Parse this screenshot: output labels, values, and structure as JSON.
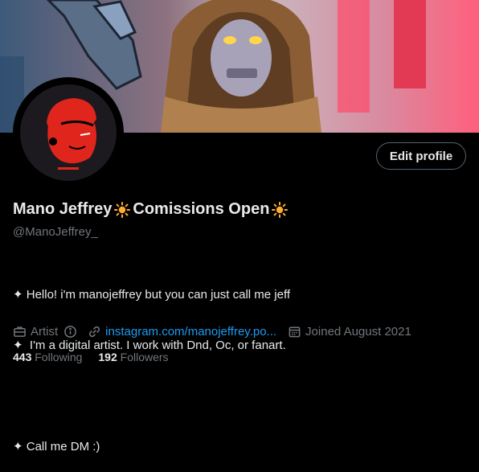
{
  "profile": {
    "name": "Mano Jeffrey",
    "status_text": "Comissions Open",
    "handle": "@ManoJeffrey_",
    "edit_label": "Edit profile",
    "bio_lines": [
      "✦ Hello! i'm manojeffrey but you can just call me jeff",
      "✦  I'm a digital artist. I work with Dnd, Oc, or fanart.",
      "",
      "✦ Call me DM :)"
    ],
    "category": "Artist",
    "link": "instagram.com/manojeffrey.po...",
    "joined": "Joined August 2021",
    "following_count": "443",
    "following_label": "Following",
    "followers_count": "192",
    "followers_label": "Followers"
  },
  "icons": {
    "sun": "sun-icon",
    "briefcase": "briefcase-icon",
    "info": "info-icon",
    "link": "link-icon",
    "calendar": "calendar-icon"
  },
  "colors": {
    "accent": "#1d9bf0",
    "muted": "#71767b",
    "sun": "#ffac33",
    "avatar_red": "#e0261c"
  }
}
